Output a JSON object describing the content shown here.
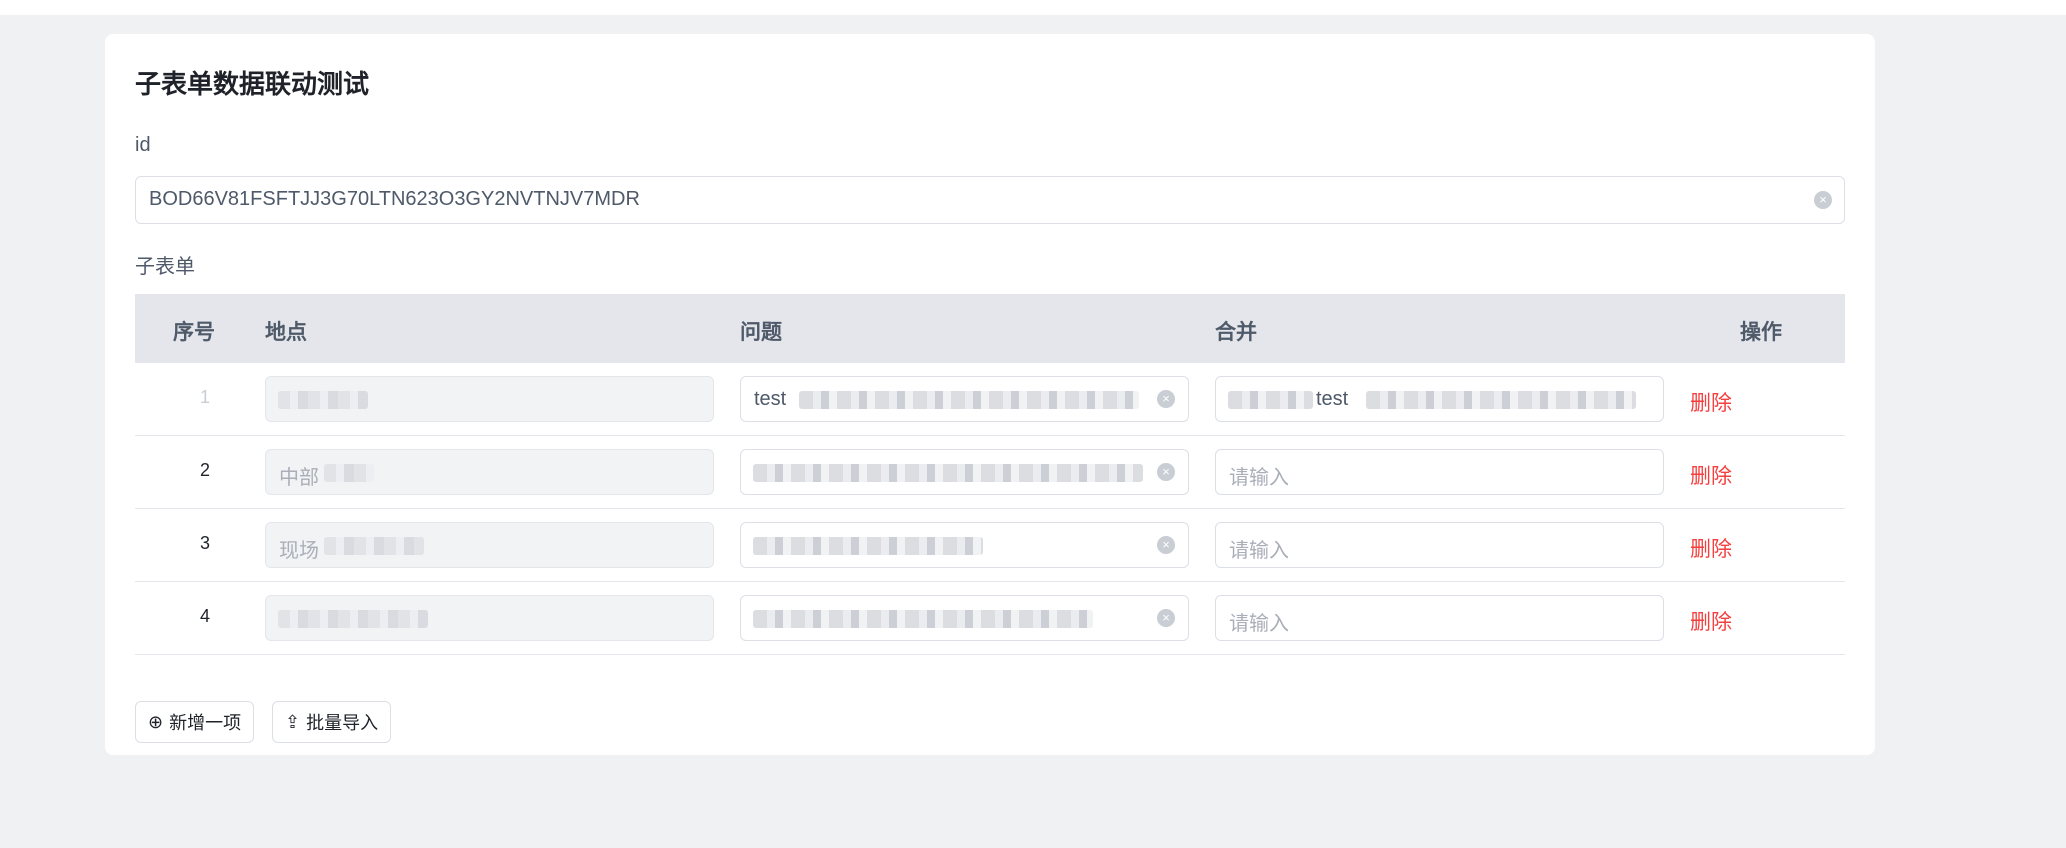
{
  "form": {
    "title": "子表单数据联动测试",
    "id_label": "id",
    "id_value": "BOD66V81FSFTJJ3G70LTN623O3GY2NVTNJV7MDR",
    "subform_label": "子表单"
  },
  "table": {
    "headers": [
      "序号",
      "地点",
      "问题",
      "合并",
      "操作"
    ],
    "rows": [
      {
        "index": "1",
        "location": "",
        "question": "test",
        "merge": "test",
        "action": "删除"
      },
      {
        "index": "2",
        "location": "中部",
        "question": "",
        "merge": "",
        "merge_placeholder": "请输入",
        "action": "删除"
      },
      {
        "index": "3",
        "location": "现场",
        "question": "",
        "merge": "",
        "merge_placeholder": "请输入",
        "action": "删除"
      },
      {
        "index": "4",
        "location": "",
        "question": "",
        "merge": "",
        "merge_placeholder": "请输入",
        "action": "删除"
      }
    ]
  },
  "buttons": {
    "add": "新增一项",
    "import": "批量导入"
  },
  "icons": {
    "clear": "clear-circle-icon",
    "add": "plus-circle-icon",
    "import": "upload-icon"
  },
  "colors": {
    "background": "#f0f1f3",
    "header": "#e5e6eb",
    "danger": "#f53f3f",
    "placeholder": "#a9aeb8"
  }
}
